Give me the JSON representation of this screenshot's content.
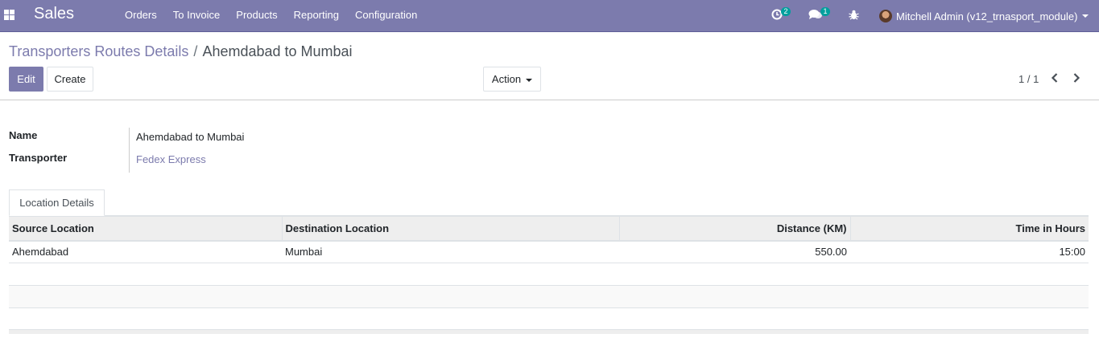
{
  "navbar": {
    "app_name": "Sales",
    "menu": [
      "Orders",
      "To Invoice",
      "Products",
      "Reporting",
      "Configuration"
    ],
    "activity_count": "2",
    "messages_count": "1",
    "user_name": "Mitchell Admin (v12_trnasport_module)",
    "bg_color": "#7c7bad"
  },
  "breadcrumb": {
    "parent": "Transporters Routes Details",
    "separator": "/",
    "current": "Ahemdabad to Mumbai"
  },
  "toolbar": {
    "edit_label": "Edit",
    "create_label": "Create",
    "action_label": "Action",
    "pager": "1 / 1"
  },
  "form": {
    "name_label": "Name",
    "name_value": "Ahemdabad to Mumbai",
    "transporter_label": "Transporter",
    "transporter_value": "Fedex Express"
  },
  "tabs": [
    {
      "label": "Location Details",
      "active": true
    }
  ],
  "table": {
    "headers": [
      "Source Location",
      "Destination Location",
      "Distance (KM)",
      "Time in Hours"
    ],
    "rows": [
      [
        "Ahemdabad",
        "Mumbai",
        "550.00",
        "15:00"
      ]
    ]
  }
}
